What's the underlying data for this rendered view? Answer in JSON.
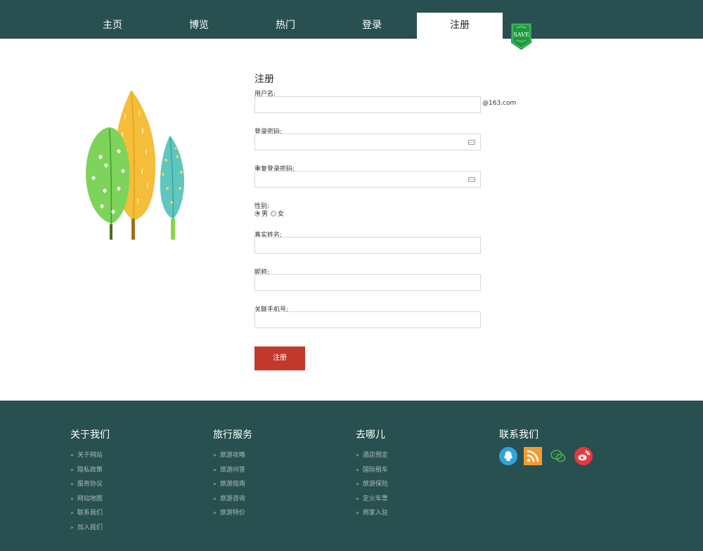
{
  "nav": {
    "items": [
      {
        "label": "主页"
      },
      {
        "label": "博览"
      },
      {
        "label": "热门"
      },
      {
        "label": "登录"
      },
      {
        "label": "注册"
      }
    ],
    "save_badge": "SAVE"
  },
  "form": {
    "title": "注册",
    "username_label": "用户名:",
    "username_suffix": "@163.com",
    "password_label": "登录密码:",
    "confirm_label": "重复登录密码:",
    "gender_label": "性别:",
    "gender_male": "男",
    "gender_female": "女",
    "realname_label": "真实姓名:",
    "nickname_label": "昵称:",
    "phone_label": "关联手机号:",
    "submit_label": "注册"
  },
  "footer": {
    "about": {
      "title": "关于我们",
      "links": [
        "关于网站",
        "隐私政策",
        "服务协议",
        "网站地图",
        "联系我们",
        "加入我们"
      ]
    },
    "service": {
      "title": "旅行服务",
      "links": [
        "旅游攻略",
        "旅游问答",
        "旅游指南",
        "旅游咨询",
        "旅游特价"
      ]
    },
    "where": {
      "title": "去哪儿",
      "links": [
        "酒店预定",
        "国际租车",
        "旅游保险",
        "定火车票",
        "商家入驻"
      ]
    },
    "contact": {
      "title": "联系我们"
    }
  },
  "colors": {
    "theme": "#285050",
    "button": "#c0392b",
    "qq": "#2fa5dc",
    "rss": "#f39c32",
    "wechat": "#4caf50",
    "weibo": "#e8383d"
  }
}
